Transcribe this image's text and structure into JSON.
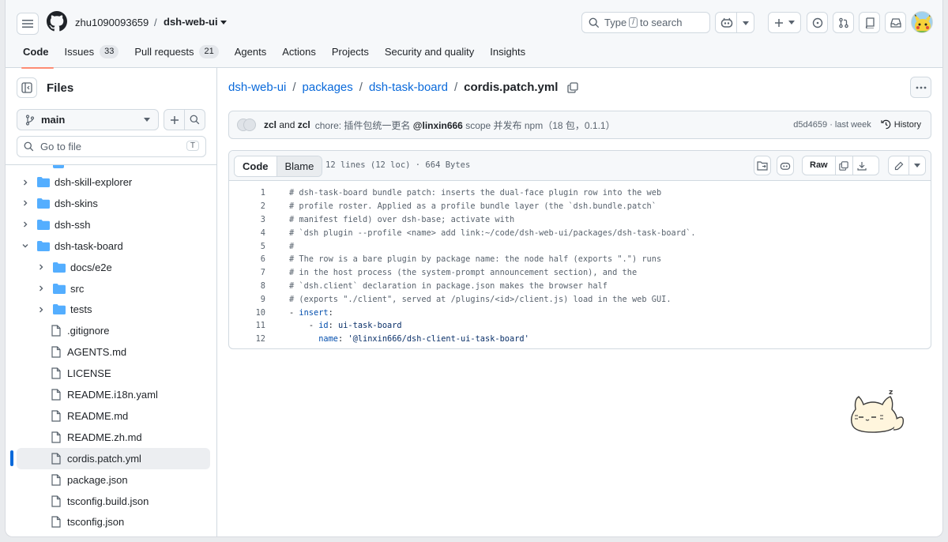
{
  "header": {
    "owner": "zhu1090093659",
    "separator": "/",
    "repo": "dsh-web-ui",
    "search": {
      "prefix": "Type",
      "key": "/",
      "suffix": "to search"
    },
    "tabs": [
      {
        "label": "Code",
        "count": ""
      },
      {
        "label": "Issues",
        "count": "33"
      },
      {
        "label": "Pull requests",
        "count": "21"
      },
      {
        "label": "Agents",
        "count": ""
      },
      {
        "label": "Actions",
        "count": ""
      },
      {
        "label": "Projects",
        "count": ""
      },
      {
        "label": "Security and quality",
        "count": ""
      },
      {
        "label": "Insights",
        "count": ""
      }
    ]
  },
  "sidebar": {
    "title": "Files",
    "branch": "main",
    "goto_placeholder": "Go to file",
    "goto_key": "T",
    "tree": [
      {
        "label": "dsh-skill-explorer",
        "type": "folder"
      },
      {
        "label": "dsh-skins",
        "type": "folder"
      },
      {
        "label": "dsh-ssh",
        "type": "folder"
      },
      {
        "label": "dsh-task-board",
        "type": "folder-open"
      },
      {
        "label": "docs/e2e",
        "type": "folder"
      },
      {
        "label": "src",
        "type": "folder"
      },
      {
        "label": "tests",
        "type": "folder"
      },
      {
        "label": ".gitignore",
        "type": "file"
      },
      {
        "label": "AGENTS.md",
        "type": "file"
      },
      {
        "label": "LICENSE",
        "type": "file"
      },
      {
        "label": "README.i18n.yaml",
        "type": "file"
      },
      {
        "label": "README.md",
        "type": "file"
      },
      {
        "label": "README.zh.md",
        "type": "file"
      },
      {
        "label": "cordis.patch.yml",
        "type": "file"
      },
      {
        "label": "package.json",
        "type": "file"
      },
      {
        "label": "tsconfig.build.json",
        "type": "file"
      },
      {
        "label": "tsconfig.json",
        "type": "file"
      }
    ]
  },
  "breadcrumb": {
    "parts": [
      "dsh-web-ui",
      "packages",
      "dsh-task-board"
    ],
    "file": "cordis.patch.yml",
    "separator": "/"
  },
  "commit": {
    "author1": "zcl",
    "and": "and",
    "author2": "zcl",
    "message_prefix": "chore: 插件包统一更名",
    "message_scope": "@linxin666",
    "message_suffix": "scope 并发布 npm（18 包，0.1.1）",
    "sha": "d5d4659",
    "time": "· last week",
    "history_label": "History"
  },
  "file": {
    "code_tab": "Code",
    "blame_tab": "Blame",
    "meta": "12 lines (12 loc) · 664 Bytes",
    "raw_label": "Raw",
    "lines": [
      {
        "n": "1",
        "text": "# dsh-task-board bundle patch: inserts the dual-face plugin row into the web"
      },
      {
        "n": "2",
        "text": "# profile roster. Applied as a profile bundle layer (the `dsh.bundle.patch`"
      },
      {
        "n": "3",
        "text": "# manifest field) over dsh-base; activate with"
      },
      {
        "n": "4",
        "text": "# `dsh plugin --profile <name> add link:~/code/dsh-web-ui/packages/dsh-task-board`."
      },
      {
        "n": "5",
        "text": "#"
      },
      {
        "n": "6",
        "text": "# The row is a bare plugin by package name: the node half (exports \".\") runs"
      },
      {
        "n": "7",
        "text": "# in the host process (the system-prompt announcement section), and the"
      },
      {
        "n": "8",
        "text": "# `dsh.client` declaration in package.json makes the browser half"
      },
      {
        "n": "9",
        "text": "# (exports \"./client\", served at /plugins/<id>/client.js) load in the web GUI."
      },
      {
        "n": "10",
        "dash": "- ",
        "key": "insert",
        "punct": ":"
      },
      {
        "n": "11",
        "indent": "    ",
        "dash": "- ",
        "key": "id",
        "punct": ": ",
        "value": "ui-task-board"
      },
      {
        "n": "12",
        "indent": "      ",
        "key": "name",
        "punct": ": ",
        "value": "'@linxin666/dsh-client-ui-task-board'"
      }
    ]
  },
  "colors": {
    "accent": "#0969da",
    "tab_underline": "#fd8c73",
    "folder": "#54aeff"
  }
}
